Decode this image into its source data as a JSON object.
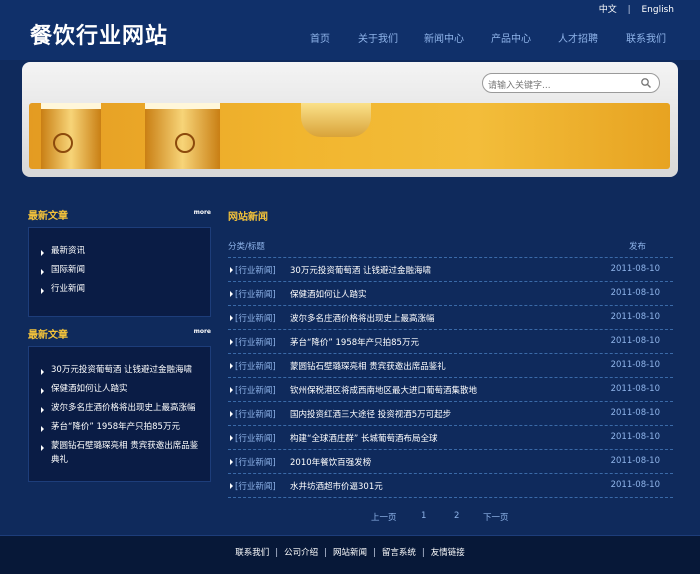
{
  "header": {
    "logo": "餐饮行业网站",
    "lang": [
      "中文",
      "English"
    ],
    "nav": [
      "首页",
      "关于我们",
      "新闻中心",
      "产品中心",
      "人才招聘",
      "联系我们"
    ]
  },
  "search": {
    "placeholder": "请输入关键字..."
  },
  "sidebar": {
    "box1": {
      "title": "最新文章",
      "more": "more",
      "items": [
        "最新资讯",
        "国际新闻",
        "行业新闻"
      ]
    },
    "box2": {
      "title": "最新文章",
      "more": "more",
      "items": [
        "30万元投资葡萄酒 让钱避过金融海啸",
        "保健酒如何让人踏实",
        "波尔多名庄酒价格将出现史上最高涨幅",
        "茅台“降价” 1958年产只拍85万元",
        "蒙圆钻石壁璐琛亮相 贵宾获邀出席品鉴",
        "典礼"
      ]
    }
  },
  "news": {
    "title": "网站新闻",
    "col_title": "分类/标题",
    "col_date": "发布",
    "rows": [
      {
        "cat": "[行业新闻]",
        "title": "30万元投资葡萄酒 让钱避过金融海啸",
        "date": "2011-08-10"
      },
      {
        "cat": "[行业新闻]",
        "title": "保健酒如何让人踏实",
        "date": "2011-08-10"
      },
      {
        "cat": "[行业新闻]",
        "title": "波尔多名庄酒价格将出现史上最高涨幅",
        "date": "2011-08-10"
      },
      {
        "cat": "[行业新闻]",
        "title": "茅台“降价” 1958年产只拍85万元",
        "date": "2011-08-10"
      },
      {
        "cat": "[行业新闻]",
        "title": "蒙圆钻石壁璐琛亮相 贵宾获邀出席品鉴礼",
        "date": "2011-08-10"
      },
      {
        "cat": "[行业新闻]",
        "title": "钦州保税港区将成西南地区最大进口葡萄酒集散地",
        "date": "2011-08-10"
      },
      {
        "cat": "[行业新闻]",
        "title": "国内投资红酒三大途径 投资视酒5万可起步",
        "date": "2011-08-10"
      },
      {
        "cat": "[行业新闻]",
        "title": "构建“全球酒庄群” 长城葡萄酒布局全球",
        "date": "2011-08-10"
      },
      {
        "cat": "[行业新闻]",
        "title": "2010年餐饮百强发榜",
        "date": "2011-08-10"
      },
      {
        "cat": "[行业新闻]",
        "title": "水井坊酒超市价逼301元",
        "date": "2011-08-10"
      }
    ],
    "pager": [
      "上一页",
      "1",
      "2",
      "下一页"
    ]
  },
  "footer": {
    "links": [
      "联系我们",
      "公司介绍",
      "网站新闻",
      "留言系统",
      "友情链接"
    ]
  }
}
